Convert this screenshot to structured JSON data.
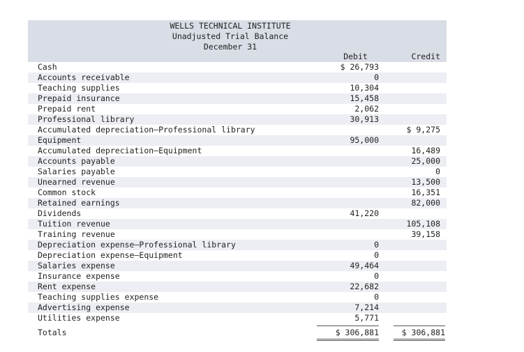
{
  "header": {
    "line1": "WELLS TECHNICAL INSTITUTE",
    "line2": "Unadjusted Trial Balance",
    "line3": "December 31",
    "debit_label": "Debit",
    "credit_label": "Credit"
  },
  "rows": [
    {
      "account": "Cash",
      "debit": "$ 26,793",
      "credit": ""
    },
    {
      "account": "Accounts receivable",
      "debit": "0",
      "credit": ""
    },
    {
      "account": "Teaching supplies",
      "debit": "10,304",
      "credit": ""
    },
    {
      "account": "Prepaid insurance",
      "debit": "15,458",
      "credit": ""
    },
    {
      "account": "Prepaid rent",
      "debit": "2,062",
      "credit": ""
    },
    {
      "account": "Professional library",
      "debit": "30,913",
      "credit": ""
    },
    {
      "account": "Accumulated depreciation—Professional library",
      "debit": "",
      "credit": "$ 9,275"
    },
    {
      "account": "Equipment",
      "debit": "95,000",
      "credit": ""
    },
    {
      "account": "Accumulated depreciation—Equipment",
      "debit": "",
      "credit": "16,489"
    },
    {
      "account": "Accounts payable",
      "debit": "",
      "credit": "25,000"
    },
    {
      "account": "Salaries payable",
      "debit": "",
      "credit": "0"
    },
    {
      "account": "Unearned revenue",
      "debit": "",
      "credit": "13,500"
    },
    {
      "account": "Common stock",
      "debit": "",
      "credit": "16,351"
    },
    {
      "account": "Retained earnings",
      "debit": "",
      "credit": "82,000"
    },
    {
      "account": "Dividends",
      "debit": "41,220",
      "credit": ""
    },
    {
      "account": "Tuition revenue",
      "debit": "",
      "credit": "105,108"
    },
    {
      "account": "Training revenue",
      "debit": "",
      "credit": "39,158"
    },
    {
      "account": "Depreciation expense—Professional library",
      "debit": "0",
      "credit": ""
    },
    {
      "account": "Depreciation expense—Equipment",
      "debit": "0",
      "credit": ""
    },
    {
      "account": "Salaries expense",
      "debit": "49,464",
      "credit": ""
    },
    {
      "account": "Insurance expense",
      "debit": "0",
      "credit": ""
    },
    {
      "account": "Rent expense",
      "debit": "22,682",
      "credit": ""
    },
    {
      "account": "Teaching supplies expense",
      "debit": "0",
      "credit": ""
    },
    {
      "account": "Advertising expense",
      "debit": "7,214",
      "credit": ""
    },
    {
      "account": "Utilities expense",
      "debit": "5,771",
      "credit": ""
    }
  ],
  "totals": {
    "label": "Totals",
    "debit": "$ 306,881",
    "credit": "$ 306,881"
  }
}
